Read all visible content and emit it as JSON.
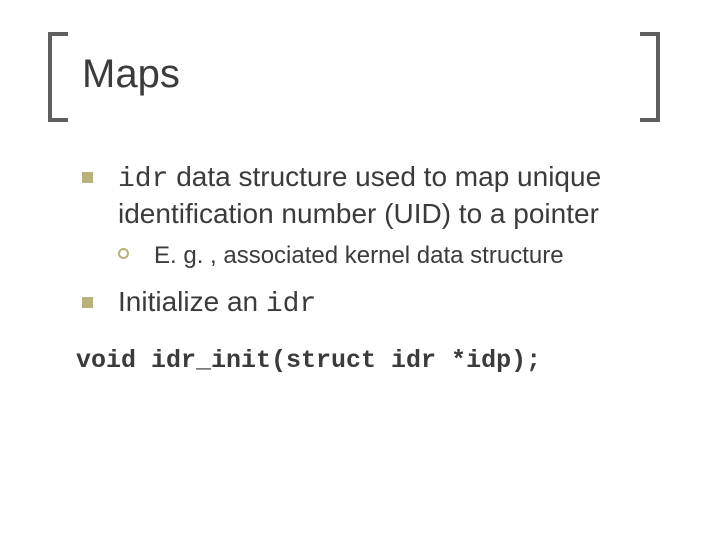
{
  "title": "Maps",
  "bullets": {
    "b1": {
      "code": "idr",
      "rest": " data structure used to map unique identification number (UID) to a pointer"
    },
    "sub1": "E. g. , associated kernel data structure",
    "b2": {
      "pre": "Initialize an ",
      "code": "idr"
    }
  },
  "code": "void idr_init(struct idr *idp);"
}
